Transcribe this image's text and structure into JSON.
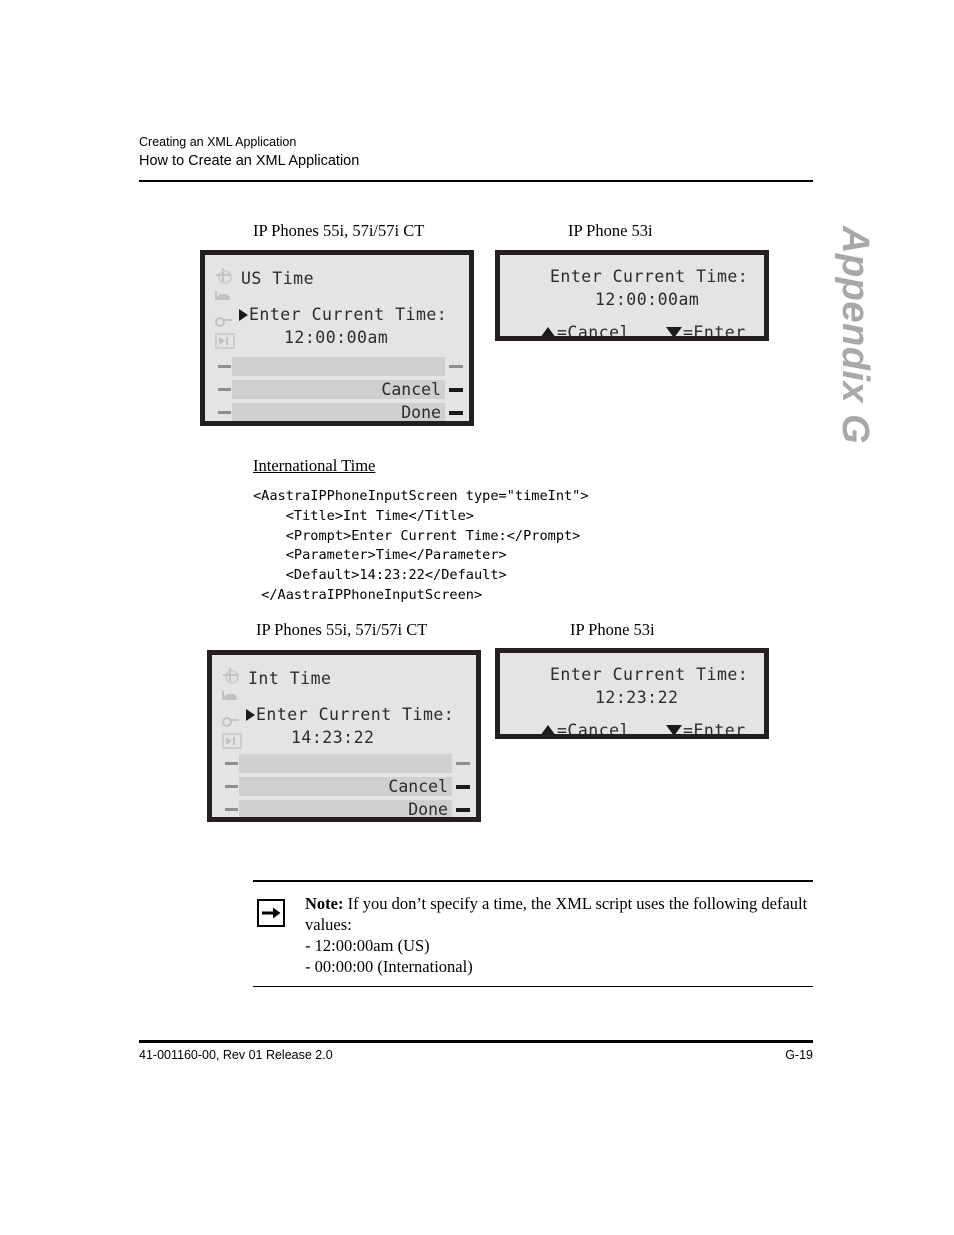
{
  "header": {
    "line1": "Creating an XML Application",
    "line2": "How to Create an XML Application"
  },
  "appendix_tab": {
    "label": "Appendix G",
    "color": "#a8a8a8"
  },
  "captions": {
    "phones_55i_top": "IP Phones 55i, 57i/57i CT",
    "phone_53i_top": "IP Phone 53i",
    "phones_55i_bottom": "IP Phones 55i, 57i/57i CT",
    "phone_53i_bottom": "IP Phone 53i"
  },
  "screen_us_55i": {
    "title": "US Time",
    "prompt": "Enter Current Time:",
    "value": "12:00:00am",
    "softkeys": [
      "",
      "Cancel",
      "Done"
    ],
    "icons": [
      "star-icon",
      "phone-icon",
      "key-icon",
      "voicemail-icon"
    ]
  },
  "screen_us_53i": {
    "prompt": "Enter Current Time:",
    "value": "12:00:00am",
    "cancel_label": "=Cancel",
    "enter_label": "=Enter"
  },
  "section": {
    "heading": "International Time"
  },
  "code": {
    "lines": [
      "<AastraIPPhoneInputScreen type=\"timeInt\">",
      "    <Title>Int Time</Title>",
      "    <Prompt>Enter Current Time:</Prompt>",
      "    <Parameter>Time</Parameter>",
      "    <Default>14:23:22</Default>",
      " </AastraIPPhoneInputScreen>"
    ]
  },
  "screen_int_55i": {
    "title": "Int Time",
    "prompt": "Enter Current Time:",
    "value": "14:23:22",
    "softkeys": [
      "",
      "Cancel",
      "Done"
    ],
    "icons": [
      "star-icon",
      "phone-icon",
      "key-icon",
      "voicemail-icon"
    ]
  },
  "screen_int_53i": {
    "prompt": "Enter Current Time:",
    "value": "12:23:22",
    "cancel_label": "=Cancel",
    "enter_label": "=Enter"
  },
  "note": {
    "label": "Note:",
    "text": " If you don’t specify a time, the XML script uses the following default values:",
    "bullet1": "- 12:00:00am (US)",
    "bullet2": "- 00:00:00 (International)",
    "icon": "right-arrow-icon"
  },
  "footer": {
    "left": "41-001160-00, Rev 01  Release 2.0",
    "right": "G-19"
  }
}
